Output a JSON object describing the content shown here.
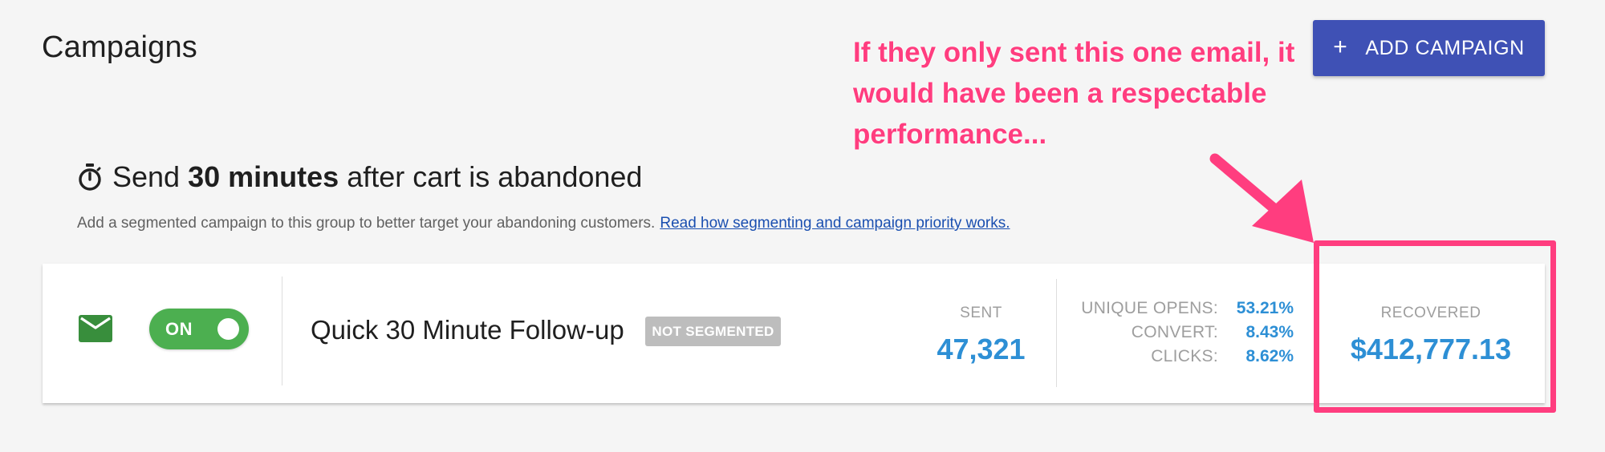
{
  "header": {
    "title": "Campaigns",
    "add_button_icon": "plus-icon",
    "add_button_label": "ADD CAMPAIGN"
  },
  "annotation": {
    "text": "If they only sent this one email, it would have been a respectable performance..."
  },
  "group": {
    "timer_icon": "timer-icon",
    "heading_prefix": "Send",
    "heading_bold": "30 minutes",
    "heading_suffix": "after cart is abandoned",
    "note": "Add a segmented campaign to this group to better target your abandoning customers.",
    "note_link": "Read how segmenting and campaign priority works."
  },
  "campaign": {
    "channel_icon": "email-icon",
    "toggle_label": "ON",
    "toggle_state": true,
    "name": "Quick 30 Minute Follow-up",
    "badge": "NOT SEGMENTED",
    "sent_label": "SENT",
    "sent_value": "47,321",
    "stats": [
      {
        "label": "UNIQUE OPENS:",
        "value": "53.21%"
      },
      {
        "label": "CONVERT:",
        "value": "8.43%"
      },
      {
        "label": "CLICKS:",
        "value": "8.62%"
      }
    ],
    "recovered_label": "RECOVERED",
    "recovered_value": "$412,777.13"
  },
  "colors": {
    "background": "#f5f5f5",
    "primary_button": "#3f51b5",
    "toggle_on": "#4caf50",
    "mail_icon": "#388e3c",
    "stat_value": "#2d8fd5",
    "annotation": "#ff3d7f",
    "badge": "#bdbdbd"
  }
}
